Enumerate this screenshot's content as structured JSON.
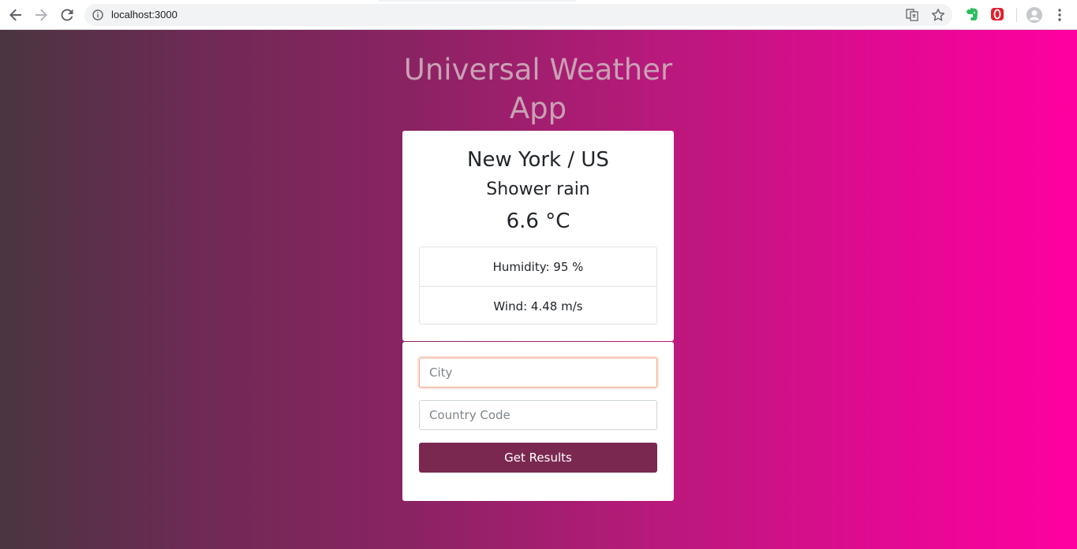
{
  "browser": {
    "url": "localhost:3000"
  },
  "app": {
    "title": "Universal Weather App"
  },
  "weather": {
    "location": "New York / US",
    "description": "Shower rain",
    "temperature": "6.6 °C",
    "humidity": "Humidity: 95 %",
    "wind": "Wind: 4.48 m/s"
  },
  "form": {
    "city_placeholder": "City",
    "country_placeholder": "Country Code",
    "submit_label": "Get Results"
  },
  "colors": {
    "gradient_start": "#4a3540",
    "gradient_end": "#ff00a0",
    "button": "#7a2850",
    "title": "#c9a1b4"
  }
}
